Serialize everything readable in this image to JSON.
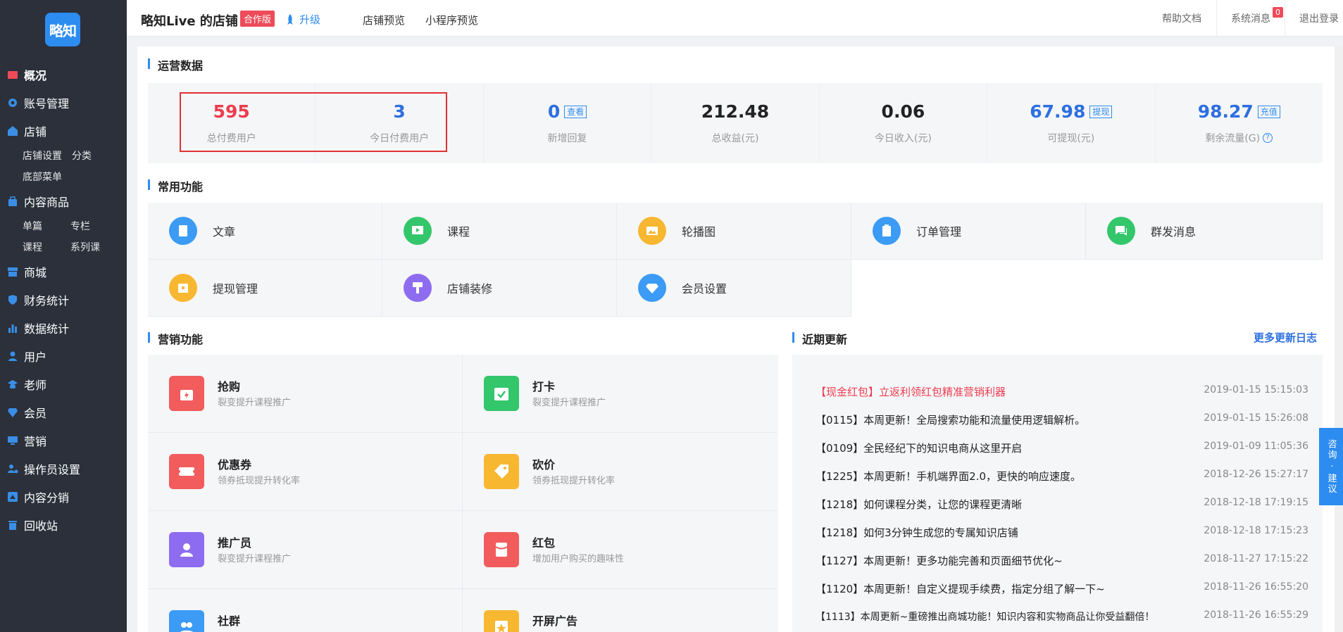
{
  "sidebar": {
    "logo": "略知",
    "items": [
      {
        "label": "概况",
        "icon": "overview-icon"
      },
      {
        "label": "账号管理",
        "icon": "gear-icon"
      },
      {
        "label": "店铺",
        "icon": "store-icon"
      },
      {
        "label": "内容商品",
        "icon": "bag-icon"
      },
      {
        "label": "商城",
        "icon": "shop-icon"
      },
      {
        "label": "财务统计",
        "icon": "shield-icon"
      },
      {
        "label": "数据统计",
        "icon": "bar-chart-icon"
      },
      {
        "label": "用户",
        "icon": "user-icon"
      },
      {
        "label": "老师",
        "icon": "teacher-icon"
      },
      {
        "label": "会员",
        "icon": "diamond-icon"
      },
      {
        "label": "营销",
        "icon": "monitor-icon"
      },
      {
        "label": "操作员设置",
        "icon": "user-gear-icon"
      },
      {
        "label": "内容分销",
        "icon": "share-icon"
      },
      {
        "label": "回收站",
        "icon": "trash-icon"
      }
    ],
    "store_sub": {
      "row1": [
        "店铺设置",
        "分类"
      ],
      "row2": [
        "底部菜单"
      ]
    },
    "content_sub": {
      "row1": [
        "单篇",
        "专栏"
      ],
      "row2": [
        "课程",
        "系列课"
      ]
    }
  },
  "topbar": {
    "shop_title": "略知Live 的店铺",
    "badge": "合作版",
    "upgrade": "升级",
    "store_preview": "店铺预览",
    "miniapp_preview": "小程序预览",
    "help_docs": "帮助文档",
    "system_msg": "系统消息",
    "msg_count": "0",
    "logout": "退出登录"
  },
  "sections": {
    "ops": "运营数据",
    "common": "常用功能",
    "marketing": "营销功能",
    "updates": "近期更新",
    "more_log": "更多更新日志"
  },
  "stats": [
    {
      "value": "595",
      "label": "总付费用户",
      "color": "#ed3c4e"
    },
    {
      "value": "3",
      "label": "今日付费用户",
      "color": "#2d6fe0"
    },
    {
      "value": "0",
      "label": "新增回复",
      "tag": "查看",
      "color": "#2d6fe0"
    },
    {
      "value": "212.48",
      "label": "总收益(元)"
    },
    {
      "value": "0.06",
      "label": "今日收入(元)"
    },
    {
      "value": "67.98",
      "label": "可提现(元)",
      "tag": "提现",
      "color": "#2d6fe0"
    },
    {
      "value": "98.27",
      "label": "剩余流量(G)",
      "tag": "充值",
      "color": "#2d6fe0"
    }
  ],
  "functions": [
    {
      "label": "文章",
      "color": "#3b9bf5"
    },
    {
      "label": "课程",
      "color": "#34c66b"
    },
    {
      "label": "轮播图",
      "color": "#f7b731"
    },
    {
      "label": "订单管理",
      "color": "#3b9bf5"
    },
    {
      "label": "群发消息",
      "color": "#34c66b"
    },
    {
      "label": "提现管理",
      "color": "#f7b731"
    },
    {
      "label": "店铺装修",
      "color": "#8e6cf0"
    },
    {
      "label": "会员设置",
      "color": "#3b9bf5"
    }
  ],
  "marketing": [
    {
      "title": "抢购",
      "desc": "裂变提升课程推广",
      "color": "#f25c5c"
    },
    {
      "title": "打卡",
      "desc": "裂变提升课程推广",
      "color": "#34c66b"
    },
    {
      "title": "优惠券",
      "desc": "领券抵现提升转化率",
      "color": "#f25c5c"
    },
    {
      "title": "砍价",
      "desc": "领券抵现提升转化率",
      "color": "#f7b731"
    },
    {
      "title": "推广员",
      "desc": "裂变提升课程推广",
      "color": "#8e6cf0"
    },
    {
      "title": "红包",
      "desc": "增加用户购买的趣味性",
      "color": "#f25c5c"
    },
    {
      "title": "社群",
      "desc": "",
      "color": "#3b9bf5"
    },
    {
      "title": "开屏广告",
      "desc": "",
      "color": "#f7b731"
    }
  ],
  "updates": [
    {
      "text": "【现金红包】立返利领红包精准营销利器",
      "date": "2019-01-15 15:15:03",
      "hot": true
    },
    {
      "text": "【0115】本周更新！全局搜索功能和流量使用逻辑解析。",
      "date": "2019-01-15 15:26:08"
    },
    {
      "text": "【0109】全民经纪下的知识电商从这里开启",
      "date": "2019-01-09 11:05:36"
    },
    {
      "text": "【1225】本周更新！手机端界面2.0，更快的响应速度。",
      "date": "2018-12-26 15:27:17"
    },
    {
      "text": "【1218】如何课程分类，让您的课程更清晰",
      "date": "2018-12-18 17:19:15"
    },
    {
      "text": "【1218】如何3分钟生成您的专属知识店铺",
      "date": "2018-12-18 17:15:23"
    },
    {
      "text": "【1127】本周更新！更多功能完善和页面细节优化~",
      "date": "2018-11-27 17:15:22"
    },
    {
      "text": "【1120】本周更新！自定义提现手续费，指定分组了解一下~",
      "date": "2018-11-26 16:55:20"
    },
    {
      "text": "【1113】本周更新~重磅推出商城功能！知识内容和实物商品让你受益翻倍！",
      "date": "2018-11-26 16:55:29"
    }
  ],
  "float_btn": "咨询 · 建议"
}
